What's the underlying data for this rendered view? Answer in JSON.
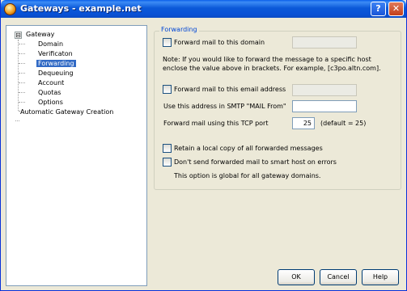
{
  "window": {
    "title": "Gateways - example.net"
  },
  "titlebar_buttons": {
    "help": "?",
    "close": "✕"
  },
  "tree": {
    "items": [
      {
        "label": "Gateway",
        "expander": "⊟"
      },
      {
        "label": "Domain"
      },
      {
        "label": "Verificaton"
      },
      {
        "label": "Forwarding",
        "selected": true
      },
      {
        "label": "Dequeuing"
      },
      {
        "label": "Account"
      },
      {
        "label": "Quotas"
      },
      {
        "label": "Options"
      },
      {
        "label": "Automatic Gateway Creation"
      }
    ]
  },
  "forwarding": {
    "group_title": "Forwarding",
    "forward_domain_label": "Forward mail to this domain",
    "forward_domain_value": "",
    "note": "Note:  If you would like to forward the message to a specific host enclose the value above in brackets.  For example, [c3po.altn.com].",
    "forward_email_label": "Forward mail to this email address",
    "forward_email_value": "",
    "smtp_from_label": "Use this address in SMTP \"MAIL From\"",
    "smtp_from_value": "",
    "tcp_port_label": "Forward mail using this TCP port",
    "tcp_port_value": "25",
    "tcp_port_default": "(default = 25)",
    "retain_copy_label": "Retain a local copy of all forwarded messages",
    "no_smart_host_label": "Don't send forwarded mail to smart host on errors",
    "global_note": "This option is global for all gateway domains."
  },
  "buttons": {
    "ok": "OK",
    "cancel": "Cancel",
    "help": "Help"
  },
  "colors": {
    "title_bar": "#0a5fe9",
    "group_title": "#0046d5",
    "selection": "#316ac5"
  }
}
